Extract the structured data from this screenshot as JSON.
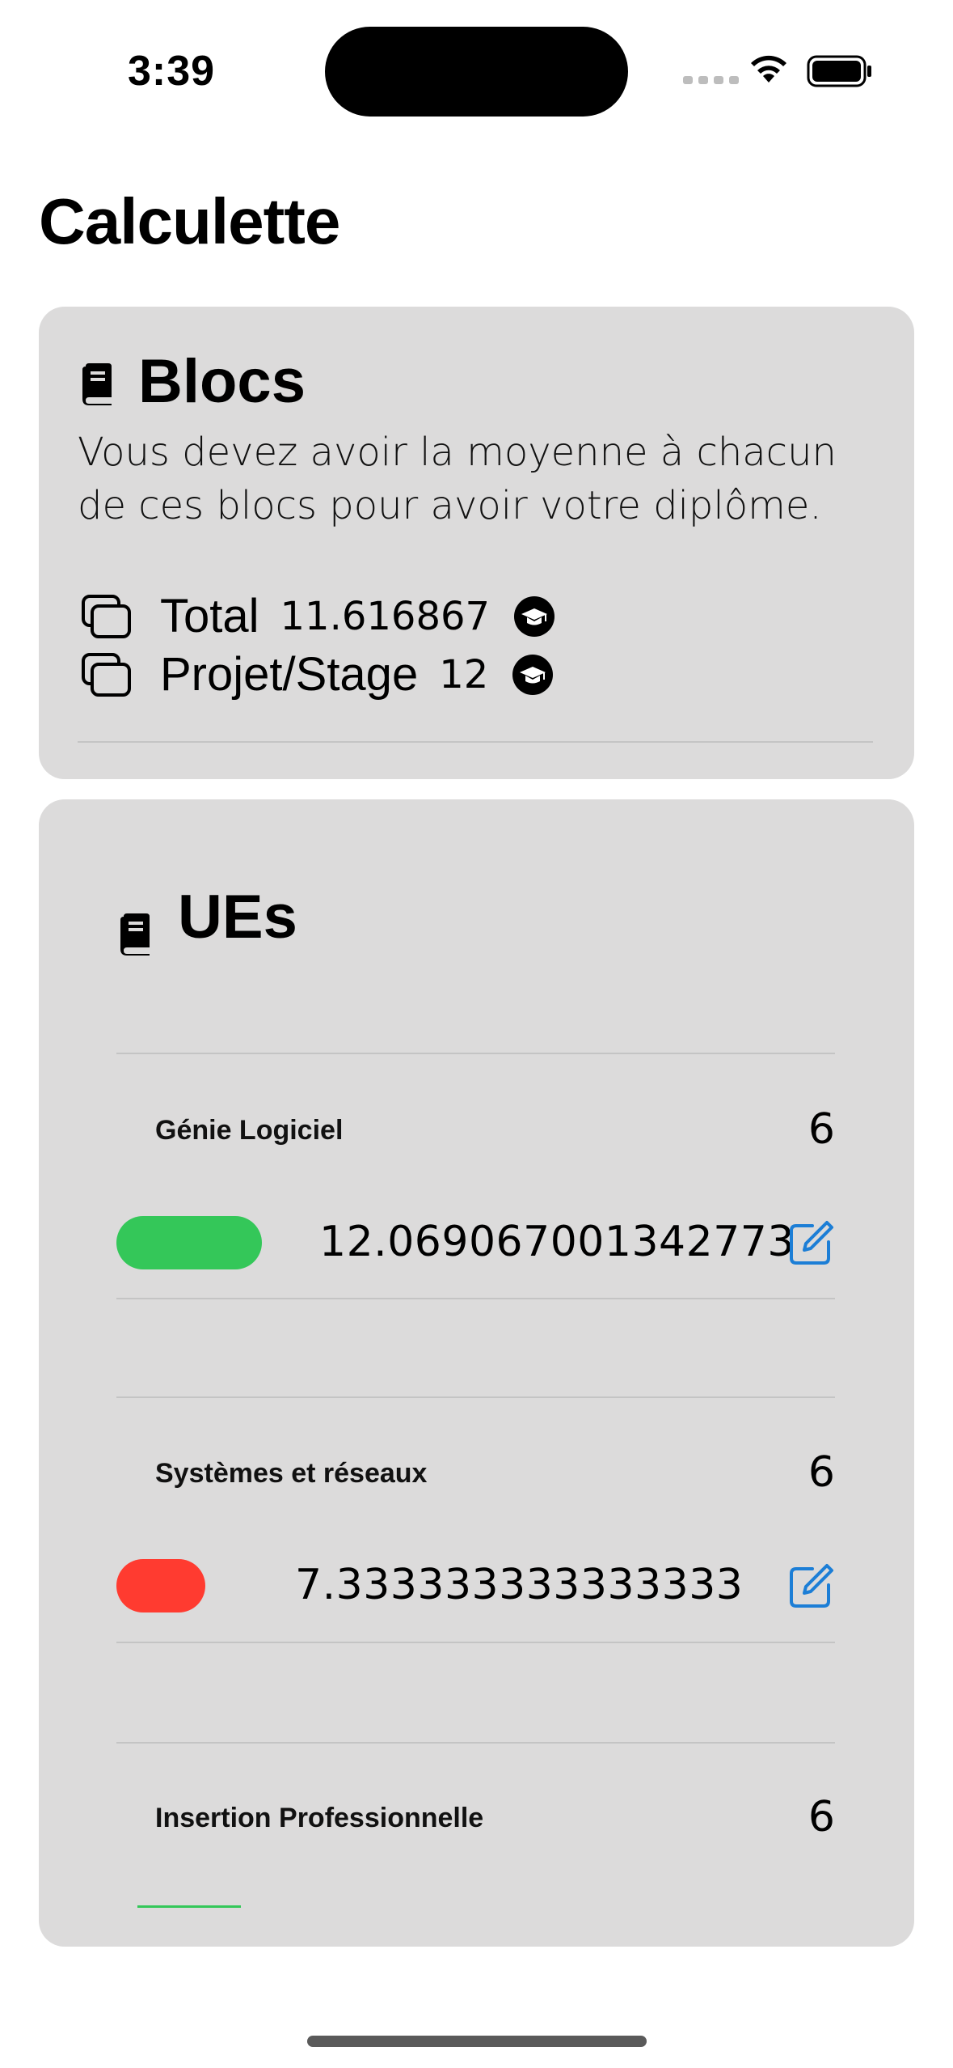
{
  "status_bar": {
    "time": "3:39"
  },
  "nav": {
    "title": "Calculette"
  },
  "blocs": {
    "heading": "Blocs",
    "icon": "book-icon",
    "description": "Vous devez avoir la moyenne à chacun de ces blocs pour avoir votre diplôme.",
    "items": [
      {
        "label": "Total",
        "value": "11.616867",
        "icon": "square-stack-icon",
        "status_icon": "graduation-cap-icon"
      },
      {
        "label": "Projet/Stage",
        "value": "12",
        "icon": "square-stack-icon",
        "status_icon": "graduation-cap-icon"
      }
    ]
  },
  "ues": {
    "heading": "UEs",
    "icon": "book-icon",
    "items": [
      {
        "name": "Génie Logiciel",
        "credits": "6",
        "grade": "12.069067001342773",
        "status_color": "#34c759",
        "edit_icon": "edit-icon"
      },
      {
        "name": "Systèmes et réseaux",
        "credits": "6",
        "grade": "7.333333333333333",
        "status_color": "#ff3b30",
        "edit_icon": "edit-icon"
      },
      {
        "name": "Insertion Professionnelle",
        "credits": "6"
      }
    ]
  },
  "colors": {
    "accent": "#1c7ed6",
    "card_background": "#dcdbdb",
    "pass": "#34c759",
    "fail": "#ff3b30"
  }
}
